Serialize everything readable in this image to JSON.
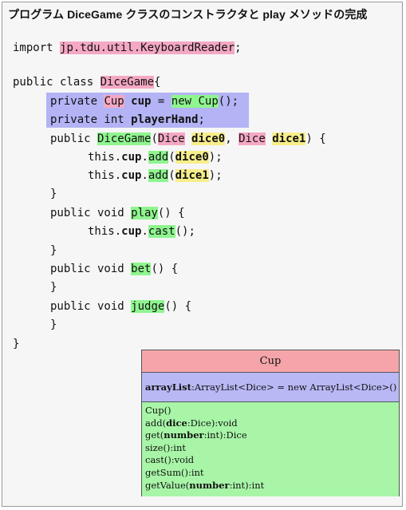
{
  "title": "プログラム DiceGame クラスのコンストラクタと play メソッドの完成",
  "code": {
    "import_kw": "import ",
    "import_pkg": "jp.tdu.util.KeyboardReader",
    "semicolon": ";",
    "public_class": "public class ",
    "class_name": "DiceGame",
    "brace_open": "{",
    "brace_close": "}",
    "private": "private ",
    "cup_type": "Cup",
    "cup_var": "cup",
    "eq_new": " = ",
    "new_cup": "new Cup",
    "parens_semi": "();",
    "private_int": "private int ",
    "player_hand": "playerHand",
    "public": "public ",
    "ctor_name": "DiceGame",
    "dice_type": "Dice",
    "dice0": "dice0",
    "dice1": "dice1",
    "this_dot": "this.",
    "add": "add",
    "public_void": "public void ",
    "play": "play",
    "cast": "cast",
    "bet": "bet",
    "judge": "judge"
  },
  "uml": {
    "class_name": "Cup",
    "attr_name": "arrayList",
    "attr_rest": ":ArrayList<Dice> = new ArrayList<Dice>()",
    "ops": {
      "cup": "Cup()",
      "add_pre": "add(",
      "add_param": "dice",
      "add_post": ":Dice):void",
      "get_pre": "get(",
      "get_param": "number",
      "get_post": ":int):Dice",
      "size": "size():int",
      "cast": "cast():void",
      "getsum": "getSum():int",
      "getvalue_pre": "getValue(",
      "getvalue_param": "number",
      "getvalue_post": ":int):int"
    }
  }
}
